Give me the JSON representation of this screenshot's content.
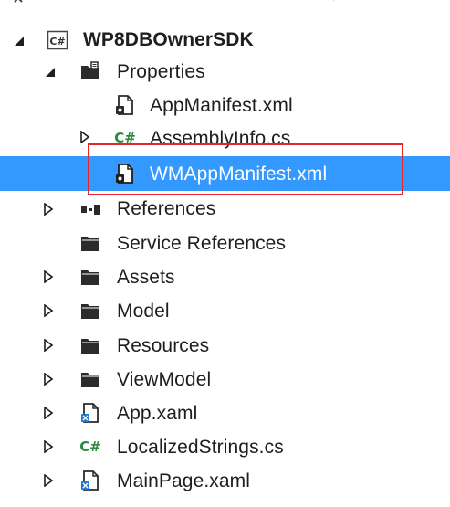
{
  "solution_explorer": {
    "project": {
      "name": "WP8DBOwnerSDK",
      "icon": "csharp-project-icon",
      "expanded": true
    },
    "items": [
      {
        "label": "Properties",
        "icon": "properties-folder-icon",
        "expanded": true
      },
      {
        "label": "AppManifest.xml",
        "icon": "xml-manifest-file-icon"
      },
      {
        "label": "AssemblyInfo.cs",
        "icon": "csharp-file-icon",
        "expander": "collapsed"
      },
      {
        "label": "WMAppManifest.xml",
        "icon": "xml-manifest-file-icon",
        "selected": true
      },
      {
        "label": "References",
        "icon": "references-icon",
        "expander": "collapsed"
      },
      {
        "label": "Service References",
        "icon": "folder-icon"
      },
      {
        "label": "Assets",
        "icon": "folder-icon",
        "expander": "collapsed"
      },
      {
        "label": "Model",
        "icon": "folder-icon",
        "expander": "collapsed"
      },
      {
        "label": "Resources",
        "icon": "folder-icon",
        "expander": "collapsed"
      },
      {
        "label": "ViewModel",
        "icon": "folder-icon",
        "expander": "collapsed"
      },
      {
        "label": "App.xaml",
        "icon": "xaml-file-icon",
        "expander": "collapsed"
      },
      {
        "label": "LocalizedStrings.cs",
        "icon": "csharp-file-icon",
        "expander": "collapsed"
      },
      {
        "label": "MainPage.xaml",
        "icon": "xaml-file-icon",
        "expander": "collapsed"
      }
    ],
    "highlight_color": "#e5242c",
    "selection_color": "#3399ff"
  }
}
